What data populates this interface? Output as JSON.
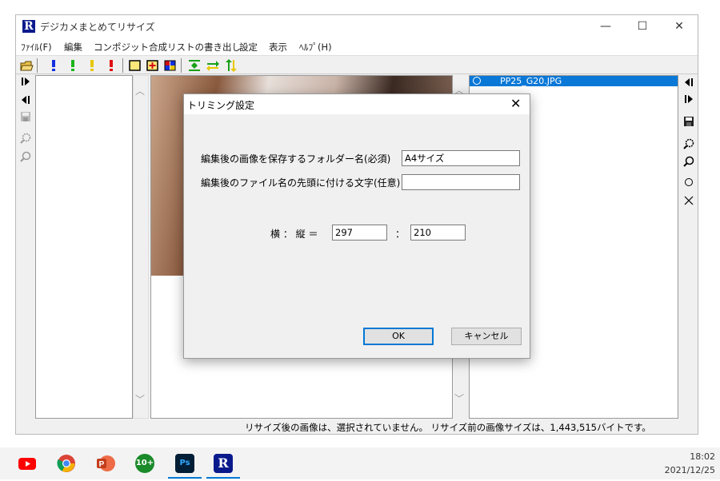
{
  "window": {
    "title": "デジカメまとめてリサイズ",
    "icon_letter": "R",
    "controls": {
      "minimize": "—",
      "maximize": "☐",
      "close": "✕"
    }
  },
  "menu": [
    "ﾌｧｲﾙ(F)",
    "編集",
    "コンポジット合成",
    "リストの書き出し",
    "設定",
    "表示",
    "ﾍﾙﾌﾟ(H)"
  ],
  "toolbar": {
    "icons": [
      "open-folder-icon",
      "exclaim-blue-icon",
      "exclaim-green-icon",
      "exclaim-yellow-icon",
      "exclaim-red-icon",
      "frame-square-icon",
      "crop-plus-icon",
      "grid-color-icon",
      "fit-vertical-icon",
      "swap-horizontal-icon",
      "swap-vertical-icon"
    ],
    "colors": {
      "blue": "#1030e0",
      "green": "#19b419",
      "yellow": "#e6c800",
      "red": "#e01010"
    }
  },
  "file_list": {
    "items": [
      {
        "name": "PP25_G20.JPG",
        "selected": true
      }
    ]
  },
  "status": {
    "text": "リサイズ後の画像は、選択されていません。 リサイズ前の画像サイズは、1,443,515バイトです。"
  },
  "dialog": {
    "title": "トリミング設定",
    "folder_label": "編集後の画像を保存するフォルダー名(必須)",
    "folder_value": "A4サイズ",
    "prefix_label": "編集後のファイル名の先頭に付ける文字(任意)",
    "prefix_value": "",
    "ratio_label": "横 ： 縦 ＝",
    "ratio_w": "297",
    "ratio_sep": "：",
    "ratio_h": "210",
    "ok_label": "OK",
    "cancel_label": "キャンセル"
  },
  "taskbar": {
    "apps": [
      "youtube-icon",
      "chrome-icon",
      "powerpoint-icon",
      "green-10-plus-icon",
      "photoshop-icon",
      "resize-app-icon"
    ],
    "badge_10": "10+",
    "ps_label": "Ps",
    "r_label": "R",
    "time": "18:02",
    "date": "2021/12/25"
  }
}
